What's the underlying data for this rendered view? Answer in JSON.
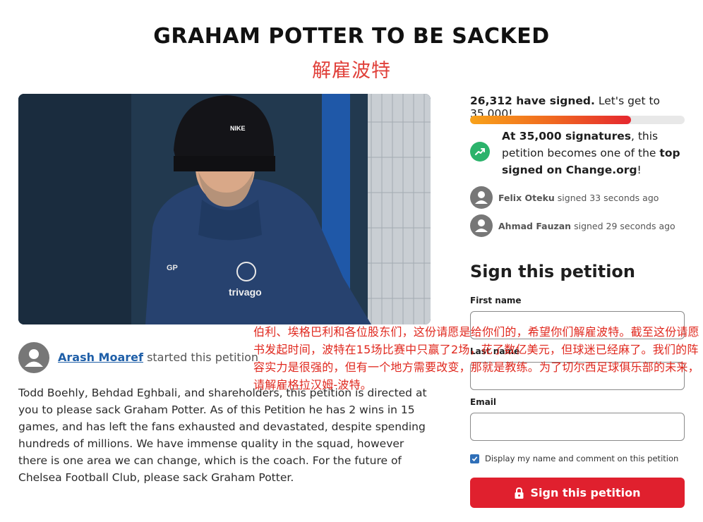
{
  "petition": {
    "title": "GRAHAM POTTER TO BE SACKED",
    "title_cn": "解雇波特"
  },
  "progress": {
    "signed_count": "26,312 have signed.",
    "goal_text": "Let's get to 35,000!",
    "fraction": 0.75,
    "milestone_bold": "At 35,000 signatures",
    "milestone_mid": ", this petition becomes one of the ",
    "milestone_bold2": "top signed on Change.org",
    "milestone_end": "!"
  },
  "recent_signers": [
    {
      "name": "Felix Oteku",
      "action": "signed 33 seconds ago"
    },
    {
      "name": "Ahmad Fauzan",
      "action": "signed 29 seconds ago"
    }
  ],
  "form": {
    "heading": "Sign this petition",
    "first_name_label": "First name",
    "last_name_label": "Last name",
    "email_label": "Email",
    "checkbox_label": "Display my name and comment on this petition",
    "checkbox_checked": true,
    "submit_label": "Sign this petition"
  },
  "starter": {
    "name": "Arash Moaref",
    "action": "started this petition"
  },
  "body": "Todd Boehly, Behdad Eghbali, and shareholders, this petition is directed at you to please sack Graham Potter. As of this Petition he has 2 wins in 15 games, and has left the fans exhausted and devastated, despite spending hundreds of millions. We have immense quality in the squad, however there is one area we can change, which is the coach. For the future of Chelsea Football Club, please sack Graham Potter.",
  "overlay_cn": "伯利、埃格巴利和各位股东们，这份请愿是给你们的，希望你们解雇波特。截至这份请愿书发起时间，波特在15场比赛中只赢了2场，花了数亿美元，但球迷已经麻了。我们的阵容实力是很强的，但有一个地方需要改变，那就是教练。为了切尔西足球俱乐部的未来，请解雇格拉汉姆-波特。",
  "photo_text": {
    "beanie_logo": "NIKE",
    "initials": "GP",
    "sponsor": "trivago"
  },
  "colors": {
    "accent_red": "#e0202e",
    "goal_green": "#2bb36b",
    "link_blue": "#1f5fa8",
    "overlay_red": "#e0281e"
  }
}
